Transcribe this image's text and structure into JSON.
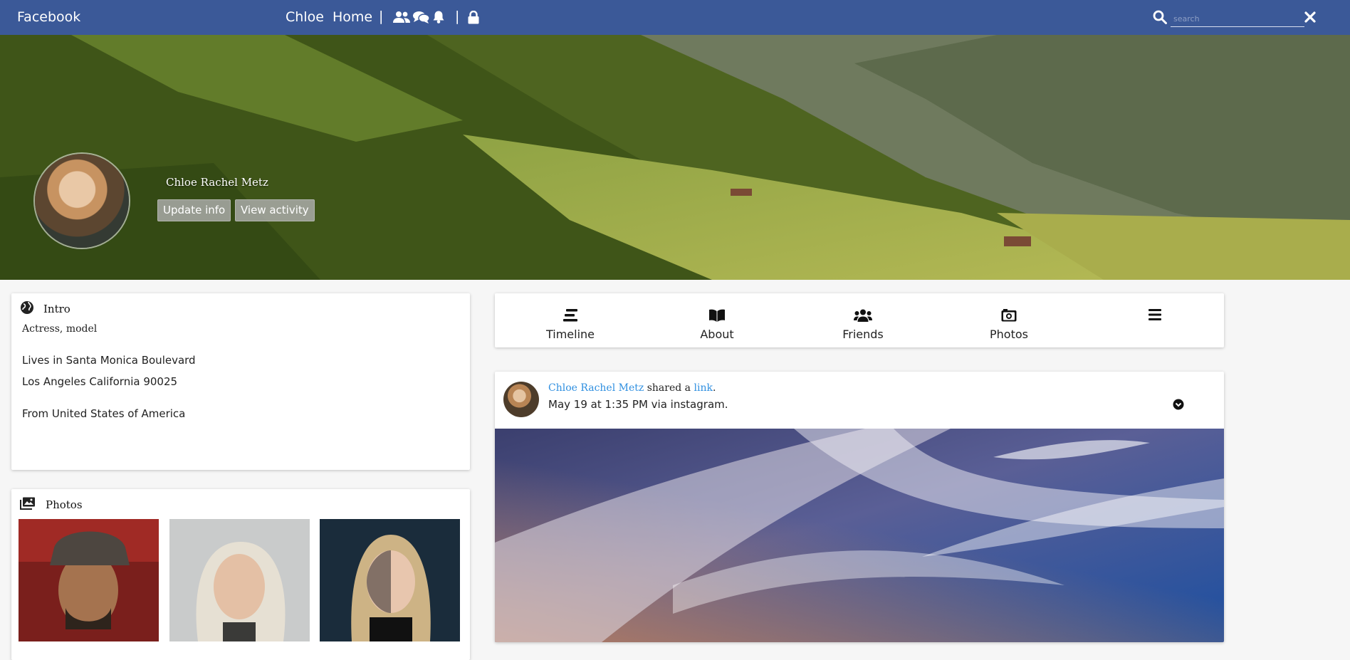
{
  "topbar": {
    "brand": "Facebook",
    "user_link": "Chloe",
    "home_link": "Home",
    "separator": "|",
    "search_placeholder": "search",
    "background_color": "#3b5998"
  },
  "cover": {
    "name": "Chloe Rachel Metz",
    "update_button": "Update info",
    "activity_button": "View activity"
  },
  "intro": {
    "title": "Intro",
    "occupation": "Actress, model",
    "address_line1": "Lives in Santa Monica Boulevard",
    "address_line2": "Los Angeles California 90025",
    "from": "From United States of America"
  },
  "photos": {
    "title": "Photos"
  },
  "tabs": [
    {
      "label": "Timeline",
      "icon": "timeline-icon"
    },
    {
      "label": "About",
      "icon": "book-icon"
    },
    {
      "label": "Friends",
      "icon": "users-icon"
    },
    {
      "label": "Photos",
      "icon": "camera-icon"
    },
    {
      "label": "",
      "icon": "menu-icon"
    }
  ],
  "post": {
    "author": "Chloe Rachel Metz",
    "shared_text": "shared a",
    "link_text": "link",
    "period": ".",
    "meta": "May 19 at 1:35 PM via instagram."
  },
  "colors": {
    "link": "#2f8fe0",
    "page_background": "#f6f6f6"
  }
}
